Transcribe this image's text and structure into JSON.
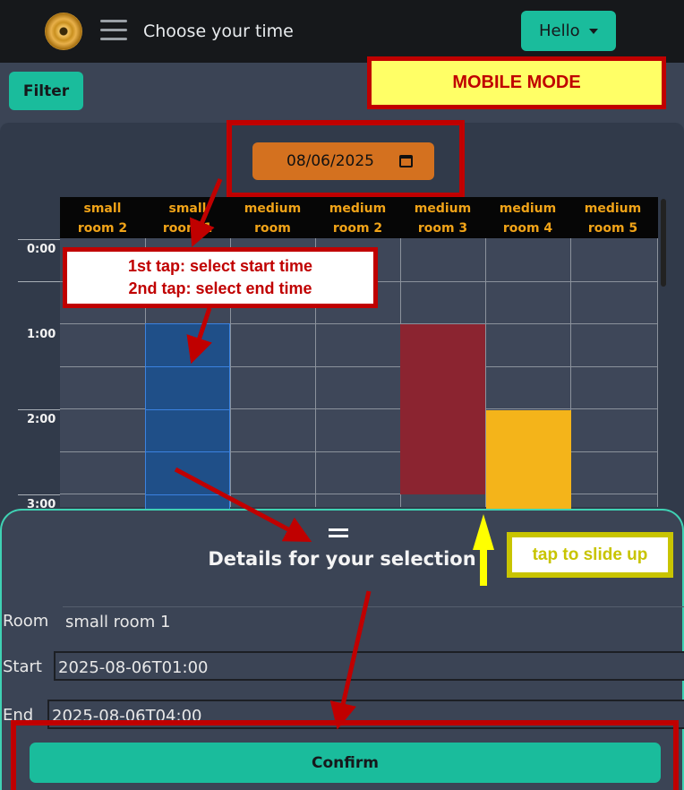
{
  "navbar": {
    "logo_icon": "vinyl-record-icon",
    "menu_icon": "hamburger-icon",
    "title": "Choose your time",
    "user_button": "Hello"
  },
  "toolbar": {
    "filter_label": "Filter"
  },
  "annotations": {
    "mobile_mode": "MOBILE MODE",
    "tap_line1": "1st tap: select start time",
    "tap_line2": "2nd tap: select end time",
    "slide_up": "tap to slide up"
  },
  "date_picker": {
    "value": "08/06/2025",
    "icon": "calendar-icon"
  },
  "rooms": [
    {
      "line1": "small",
      "line2": "room 2"
    },
    {
      "line1": "small",
      "line2": "room 1"
    },
    {
      "line1": "medium",
      "line2": "room"
    },
    {
      "line1": "medium",
      "line2": "room 2"
    },
    {
      "line1": "medium",
      "line2": "room 3"
    },
    {
      "line1": "medium",
      "line2": "room 4"
    },
    {
      "line1": "medium",
      "line2": "room 5"
    }
  ],
  "time_labels": [
    "0:00",
    "1:00",
    "2:00",
    "3:00"
  ],
  "bookings": [
    {
      "room": "small room 1",
      "status": "selected",
      "color": "#1f4f88"
    },
    {
      "room": "medium room 3",
      "status": "booked",
      "color": "#8b2430"
    },
    {
      "room": "medium room 4",
      "status": "booked",
      "color": "#f4b41a"
    }
  ],
  "details": {
    "title": "Details for your selection",
    "room_label": "Room",
    "room_value": "small room 1",
    "start_label": "Start",
    "start_value": "2025-08-06T01:00",
    "end_label": "End",
    "end_value": "2025-08-06T04:00",
    "confirm_label": "Confirm"
  },
  "colors": {
    "accent": "#1abc9c",
    "annotation_red": "#c00000",
    "annotation_yellow": "#c8c400",
    "header_text": "#f0a318"
  }
}
